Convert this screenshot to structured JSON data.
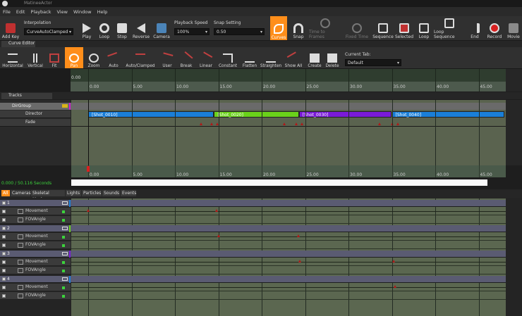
{
  "app": {
    "title": "MatineeActor"
  },
  "menu": [
    "File",
    "Edit",
    "Playback",
    "View",
    "Window",
    "Help"
  ],
  "toolbar1": {
    "add_key": "Add Key",
    "interpolation_label": "Interpolation",
    "interpolation_value": "CurveAutoClamped",
    "play": "Play",
    "loop": "Loop",
    "stop": "Stop",
    "reverse": "Reverse",
    "camera": "Camera",
    "playback_speed_label": "Playback Speed",
    "playback_speed_value": "100%",
    "snap_setting_label": "Snap Setting",
    "snap_setting_value": "0.50",
    "curves": "Curves",
    "snap": "Snap",
    "time_to_frames": "Time to Frames",
    "fixed_time": "Fixed Time",
    "sequence": "Sequence",
    "selected": "Selected",
    "loop2": "Loop",
    "loop_sequence": "Loop Sequence",
    "end": "End",
    "record": "Record",
    "movie": "Movie"
  },
  "curve_editor_tab": "Curve Editor",
  "toolbar2": {
    "horizontal": "Horizontal",
    "vertical": "Vertical",
    "fit": "Fit",
    "pan": "Pan",
    "zoom": "Zoom",
    "auto": "Auto",
    "auto_clamped": "Auto/Clamped",
    "user": "User",
    "break": "Break",
    "linear": "Linear",
    "constant": "Constant",
    "flatten": "Flatten",
    "straighten": "Straighten",
    "show_all": "Show All",
    "create": "Create",
    "delete": "Delete",
    "current_tab_label": "Current Tab:",
    "current_tab_value": "Default"
  },
  "curve_ruler": {
    "zero": "0.00",
    "ticks": [
      "0.00",
      "5.00",
      "10.00",
      "15.00",
      "20.00",
      "25.00",
      "30.00",
      "35.00",
      "40.00",
      "45.00"
    ]
  },
  "tracks_tab": "Tracks",
  "director_group": {
    "name": "DirGroup",
    "tracks": [
      "Director",
      "Fade"
    ],
    "shots": [
      {
        "label": "[Shot_0010]",
        "color": "#1a7fd8"
      },
      {
        "label": "[Shot_0020]",
        "color": "#6ad21a"
      },
      {
        "label": "[Shot_0030]",
        "color": "#7a1ad8"
      },
      {
        "label": "[Shot_0040]",
        "color": "#1a7fd8"
      }
    ],
    "fade_keys": [
      13.0,
      14.2,
      14.9,
      22.6,
      24.0,
      24.6,
      33.6,
      35.0,
      35.7
    ]
  },
  "time_readout": "0.000 / 50.116 Seconds",
  "bottom_ruler": {
    "ticks": [
      "0.00",
      "5.00",
      "10.00",
      "15.00",
      "20.00",
      "25.00",
      "30.00",
      "35.00",
      "40.00",
      "45.00"
    ]
  },
  "filter_tabs": [
    "All",
    "Cameras",
    "Skeletal Meshes",
    "Lights",
    "Particles",
    "Sounds",
    "Events"
  ],
  "groups": [
    {
      "name": "1",
      "accent": "#1a7fd8",
      "tracks": [
        "Movement",
        "FOVAngle"
      ],
      "keys": [
        0.0,
        14.8
      ]
    },
    {
      "name": "2",
      "accent": "#6ad21a",
      "tracks": [
        "Movement",
        "FOVAngle"
      ],
      "keys": [
        15.0,
        24.2
      ]
    },
    {
      "name": "3",
      "accent": "#7a1ad8",
      "tracks": [
        "Movement",
        "FOVAngle"
      ],
      "keys": [
        24.4,
        35.2
      ]
    },
    {
      "name": "4",
      "accent": "#1a7fd8",
      "tracks": [
        "Movement",
        "FOVAngle"
      ],
      "keys": [
        35.4
      ]
    }
  ]
}
